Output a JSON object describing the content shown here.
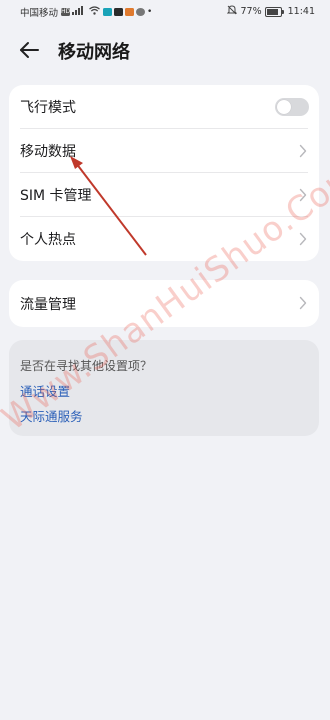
{
  "status_bar": {
    "carrier": "中国移动",
    "battery": "77%",
    "battery_level": 0.77,
    "time": "11:41"
  },
  "header": {
    "title": "移动网络"
  },
  "settings": {
    "airplane_mode": {
      "label": "飞行模式",
      "enabled": false
    },
    "mobile_data": {
      "label": "移动数据"
    },
    "sim_management": {
      "label": "SIM 卡管理"
    },
    "hotspot": {
      "label": "个人热点"
    }
  },
  "traffic": {
    "label": "流量管理"
  },
  "suggestions": {
    "question": "是否在寻找其他设置项？",
    "links": [
      "通话设置",
      "天际通服务"
    ]
  },
  "watermark": {
    "text": "Www.ShanHuiShuo.Com 善会说"
  },
  "annotation_color": "#c0392b"
}
